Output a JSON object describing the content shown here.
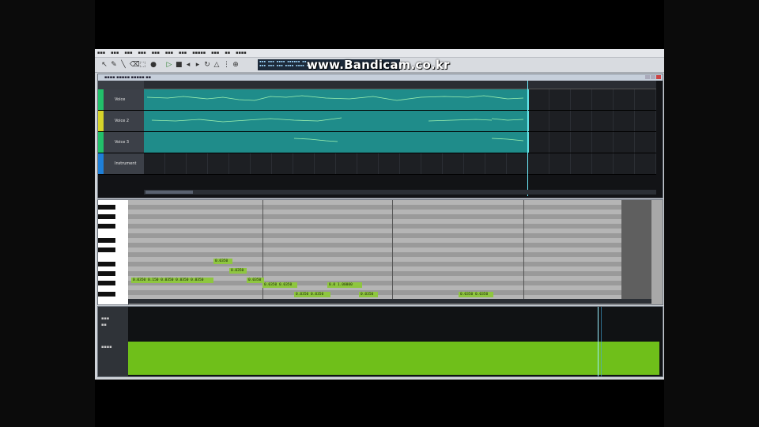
{
  "watermark": "www.Bandicam.co.kr",
  "tracks": [
    {
      "name": "Voice",
      "color": "#22c06a"
    },
    {
      "name": "Voice 2",
      "color": "#d6d32a"
    },
    {
      "name": "Voice 3",
      "color": "#22c06a"
    },
    {
      "name": "Instrument",
      "color": "#1e7fd8"
    }
  ],
  "notes": [
    {
      "text": "0.0350"
    },
    {
      "text": "0.0350"
    },
    {
      "text": "0.0350 0.150 0.0350 0.0350 0.0350"
    },
    {
      "text": "0.0350"
    },
    {
      "text": "0.0350 0.0350"
    },
    {
      "text": "0.0 1.00000"
    },
    {
      "text": "0.0350 0.0350"
    },
    {
      "text": "0.0350"
    },
    {
      "text": "0.0350 0.0350"
    }
  ]
}
